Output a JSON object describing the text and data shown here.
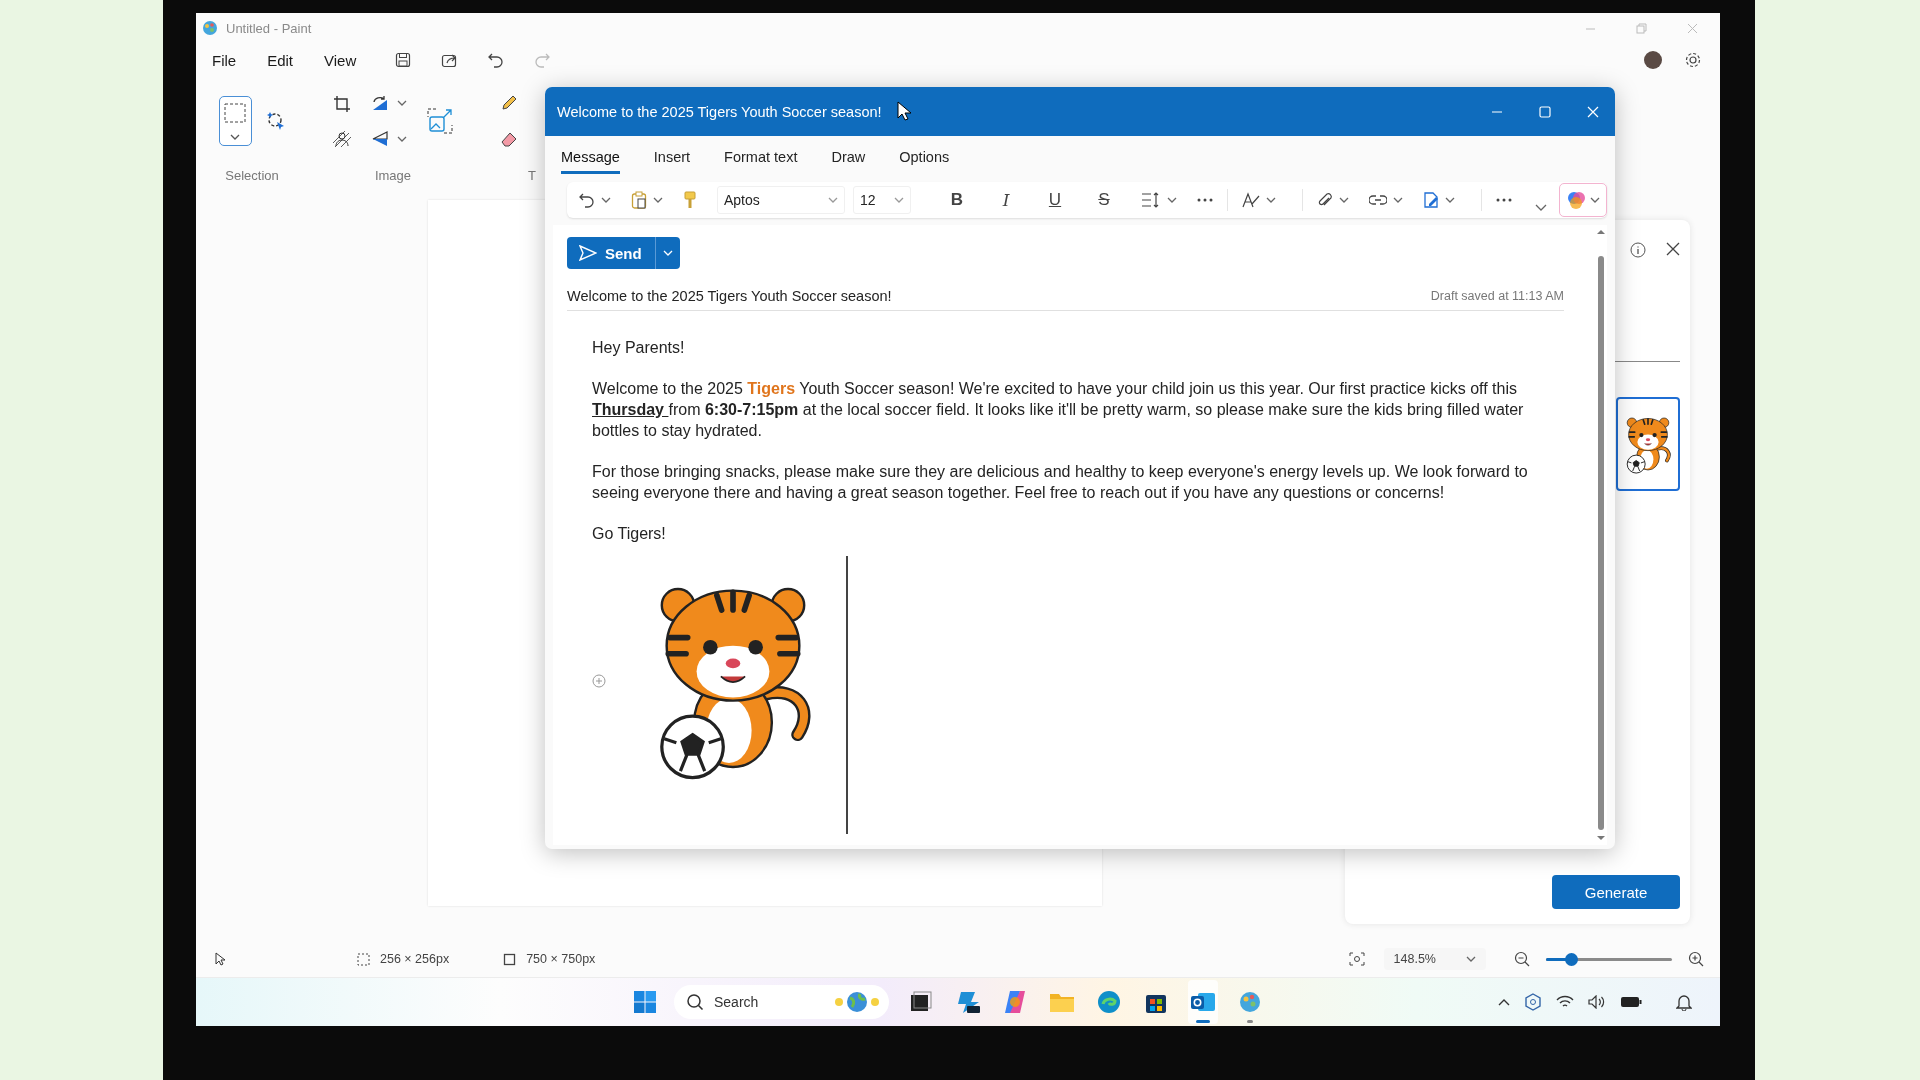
{
  "paint": {
    "title": "Untitled - Paint",
    "menu": [
      "File",
      "Edit",
      "View"
    ],
    "ribbon_groups": [
      "Selection",
      "Image",
      "T"
    ],
    "status_bar": {
      "selection_size": "256 × 256px",
      "canvas_size": "750 × 750px",
      "zoom": "148.5%",
      "zoom_slider": {
        "level": 0.2
      }
    },
    "cocreator_panel": {
      "generate_button": "Generate"
    }
  },
  "mail": {
    "title": "Welcome to the 2025 Tigers Youth Soccer season!",
    "tabs": [
      {
        "label": "Message",
        "selected": true
      },
      {
        "label": "Insert",
        "selected": false
      },
      {
        "label": "Format text",
        "selected": false
      },
      {
        "label": "Draw",
        "selected": false
      },
      {
        "label": "Options",
        "selected": false
      }
    ],
    "toolbar": {
      "font": "Aptos",
      "size": "12",
      "format_buttons": [
        "B",
        "I",
        "U",
        "S"
      ]
    },
    "send_button": "Send",
    "subject": "Welcome to the 2025 Tigers Youth Soccer season!",
    "draft_status": "Draft saved at 11:13 AM",
    "body": [
      {
        "segments": [
          {
            "text": "Hey Parents!",
            "kind": "plain"
          }
        ]
      },
      {
        "segments": [
          {
            "text": "Welcome to the 2025 ",
            "kind": "plain"
          },
          {
            "text": "Tigers",
            "kind": "accent"
          },
          {
            "text": " Youth Soccer season! We're excited to have your child join us this year. Our first practice kicks off this ",
            "kind": "plain"
          },
          {
            "text": "Thursday ",
            "kind": "emphasis"
          },
          {
            "text": "from ",
            "kind": "plain"
          },
          {
            "text": "6:30-7:15pm",
            "kind": "strong"
          },
          {
            "text": " at the local soccer field. It looks like it'll be pretty warm, so please make sure the kids bring filled water bottles to stay hydrated.",
            "kind": "plain"
          }
        ]
      },
      {
        "segments": [
          {
            "text": "For those bringing snacks, please make sure they are delicious and healthy to keep everyone's energy levels up. We look forward to seeing everyone there and having a great season together. Feel free to reach out if you have any questions or concerns!",
            "kind": "plain"
          }
        ]
      },
      {
        "segments": [
          {
            "text": "Go Tigers!",
            "kind": "plain"
          }
        ]
      }
    ]
  },
  "taskbar": {
    "search_placeholder": "Search",
    "apps": [
      {
        "kind": "taskview",
        "running": false,
        "focused": false
      },
      {
        "kind": "copilot-pre",
        "running": false,
        "focused": false
      },
      {
        "kind": "copilot",
        "running": false,
        "focused": false
      },
      {
        "kind": "folder",
        "running": false,
        "focused": false
      },
      {
        "kind": "edge",
        "running": false,
        "focused": false
      },
      {
        "kind": "store",
        "running": false,
        "focused": false
      },
      {
        "kind": "outlook",
        "running": true,
        "focused": true
      },
      {
        "kind": "paint",
        "running": true,
        "focused": false
      }
    ]
  }
}
